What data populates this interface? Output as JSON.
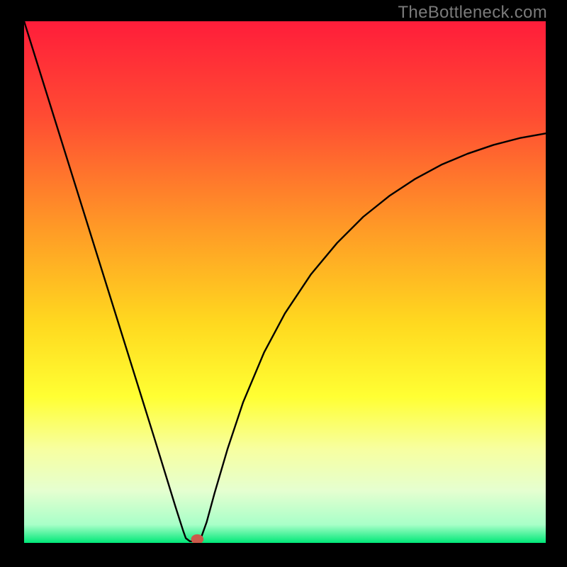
{
  "watermark": "TheBottleneck.com",
  "chart_data": {
    "type": "line",
    "title": "",
    "xlabel": "",
    "ylabel": "",
    "xlim": [
      0,
      100
    ],
    "ylim": [
      0,
      100
    ],
    "gradient_stops": [
      {
        "offset": 0.0,
        "color": "#ff1d3a"
      },
      {
        "offset": 0.18,
        "color": "#ff4b33"
      },
      {
        "offset": 0.4,
        "color": "#ff9b26"
      },
      {
        "offset": 0.58,
        "color": "#ffd91f"
      },
      {
        "offset": 0.72,
        "color": "#ffff33"
      },
      {
        "offset": 0.82,
        "color": "#f7ffa0"
      },
      {
        "offset": 0.9,
        "color": "#e5ffd0"
      },
      {
        "offset": 0.965,
        "color": "#a8ffc8"
      },
      {
        "offset": 1.0,
        "color": "#00e878"
      }
    ],
    "series": [
      {
        "name": "bottleneck-curve",
        "x": [
          0.0,
          2.5,
          5.0,
          7.5,
          10.0,
          12.5,
          15.0,
          17.5,
          20.0,
          22.5,
          25.0,
          27.0,
          29.0,
          30.5,
          31.0,
          31.8,
          33.0,
          33.5,
          34.0,
          35.0,
          36.5,
          39.0,
          42.0,
          46.0,
          50.0,
          55.0,
          60.0,
          65.0,
          70.0,
          75.0,
          80.0,
          85.0,
          90.0,
          95.0,
          100.0
        ],
        "y": [
          100.0,
          92.0,
          84.0,
          76.0,
          68.0,
          60.0,
          52.0,
          44.0,
          36.0,
          28.0,
          20.0,
          13.5,
          7.0,
          2.3,
          0.9,
          0.3,
          0.3,
          0.5,
          1.2,
          4.0,
          9.5,
          18.0,
          27.0,
          36.5,
          44.0,
          51.5,
          57.5,
          62.5,
          66.5,
          69.8,
          72.5,
          74.6,
          76.3,
          77.6,
          78.5
        ]
      }
    ],
    "marker": {
      "x": 33.2,
      "y": 0.7,
      "color": "#cb5a4a",
      "rx": 1.2,
      "ry": 0.95
    }
  }
}
